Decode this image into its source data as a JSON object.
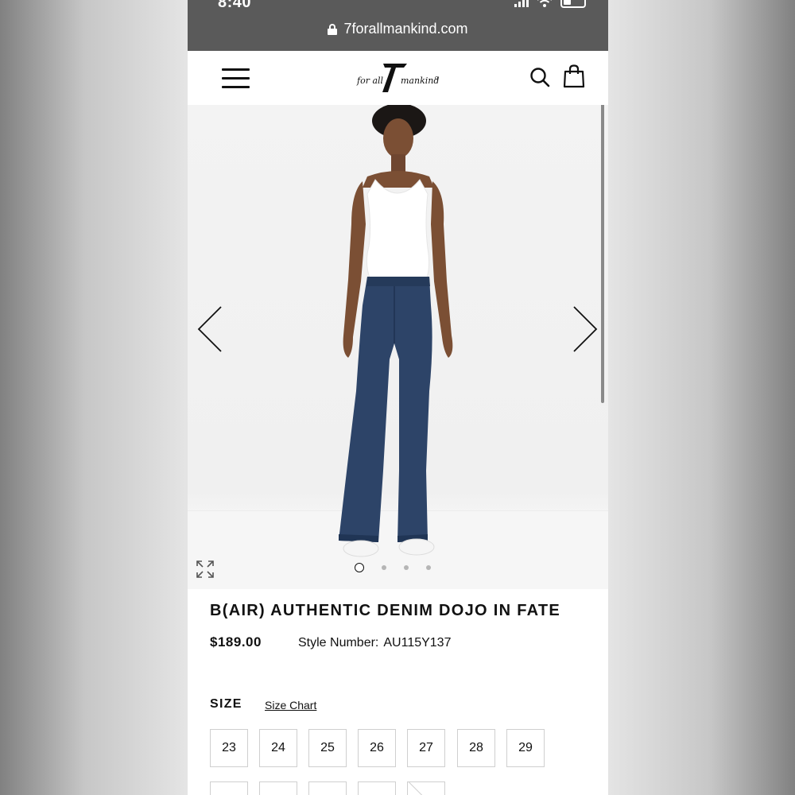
{
  "status_bar": {
    "time": "8:40"
  },
  "browser": {
    "url": "7forallmankind.com"
  },
  "header": {
    "logo_text": "7 for all mankind"
  },
  "gallery": {
    "image_count": 4,
    "active_index": 0
  },
  "product": {
    "title": "B(AIR) AUTHENTIC DENIM DOJO IN FATE",
    "price": "$189.00",
    "style_label": "Style Number:",
    "style_number": "AU115Y137"
  },
  "size_section": {
    "label": "SIZE",
    "chart_link": "Size Chart",
    "row1": [
      "23",
      "24",
      "25",
      "26",
      "27",
      "28",
      "29"
    ],
    "row2": [
      "",
      "",
      "",
      "",
      ""
    ]
  },
  "colors": {
    "status_bar": "#5a5a5a",
    "denim": "#2d4468",
    "text": "#111111",
    "border": "#cfcfcf"
  }
}
